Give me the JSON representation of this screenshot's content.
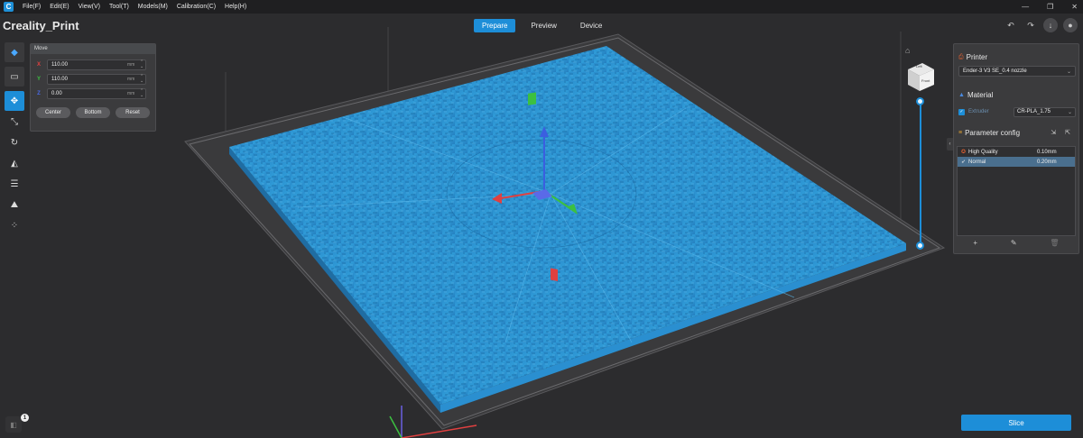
{
  "menubar": {
    "items": [
      "File(F)",
      "Edit(E)",
      "View(V)",
      "Tool(T)",
      "Models(M)",
      "Calibration(C)",
      "Help(H)"
    ],
    "window_controls": [
      "—",
      "❐",
      "✕"
    ]
  },
  "app_title": "Creality_Print",
  "mode_tabs": [
    {
      "label": "Prepare",
      "active": true
    },
    {
      "label": "Preview",
      "active": false
    },
    {
      "label": "Device",
      "active": false
    }
  ],
  "top_right_icons": [
    "undo-icon",
    "redo-icon",
    "download-icon",
    "user-icon"
  ],
  "left_toolbar": {
    "tools": [
      "cube-icon",
      "folder-icon",
      "move-icon",
      "scale-icon",
      "rotate-icon",
      "lay-flat-icon",
      "list-icon",
      "support-icon",
      "arrange-icon"
    ]
  },
  "move_panel": {
    "title": "Move",
    "x_label": "X",
    "x_value": "110.00",
    "y_label": "Y",
    "y_value": "110.00",
    "z_label": "Z",
    "z_value": "0.00",
    "unit": "mm",
    "buttons": [
      "Center",
      "Bottom",
      "Reset"
    ]
  },
  "view_cube": {
    "top": "Left",
    "front": "Front"
  },
  "right_panel": {
    "printer_title": "Printer",
    "printer_value": "Ender-3 V3 SE_0.4 nozzle",
    "material_title": "Material",
    "extruder_label": "Extruder",
    "material_value": "CR-PLA_1.75",
    "param_title": "Parameter config",
    "profiles": [
      {
        "name": "High Quality",
        "value": "0.10mm",
        "selected": false
      },
      {
        "name": "Normal",
        "value": "0.20mm",
        "selected": true
      }
    ],
    "footer_icons": [
      "+",
      "✎",
      "🗑"
    ]
  },
  "slice_label": "Slice",
  "notification_count": "1",
  "colors": {
    "accent": "#1d8ed8",
    "model": "#2f9ad4",
    "bed": "#3a3a3c",
    "background": "#2c2c2e"
  }
}
